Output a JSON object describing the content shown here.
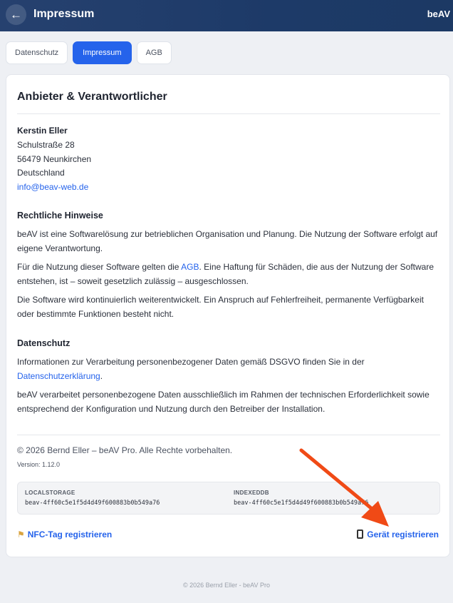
{
  "header": {
    "title": "Impressum",
    "brand": "beAV",
    "back_icon": "←"
  },
  "tabs": [
    {
      "label": "Datenschutz",
      "active": false
    },
    {
      "label": "Impressum",
      "active": true
    },
    {
      "label": "AGB",
      "active": false
    }
  ],
  "card": {
    "title": "Anbieter & Verantwortlicher",
    "provider": {
      "name": "Kerstin Eller",
      "street": "Schulstraße 28",
      "city": "56479 Neunkirchen",
      "country": "Deutschland",
      "email": "info@beav-web.de"
    },
    "legal": {
      "heading": "Rechtliche Hinweise",
      "p1": "beAV ist eine Softwarelösung zur betrieblichen Organisation und Planung. Die Nutzung der Software erfolgt auf eigene Verantwortung.",
      "p2_before": "Für die Nutzung dieser Software gelten die ",
      "p2_link": "AGB",
      "p2_after": ". Eine Haftung für Schäden, die aus der Nutzung der Software entstehen, ist – soweit gesetzlich zulässig – ausgeschlossen.",
      "p3": "Die Software wird kontinuierlich weiterentwickelt. Ein Anspruch auf Fehlerfreiheit, permanente Verfügbarkeit oder bestimmte Funktionen besteht nicht."
    },
    "privacy": {
      "heading": "Datenschutz",
      "p1_before": "Informationen zur Verarbeitung personenbezogener Daten gemäß DSGVO finden Sie in der ",
      "p1_link": "Datenschutzerklärung",
      "p1_after": ".",
      "p2": "beAV verarbeitet personenbezogene Daten ausschließlich im Rahmen der technischen Erforderlichkeit sowie entsprechend der Konfiguration und Nutzung durch den Betreiber der Installation."
    },
    "copyright": "© 2026 Bernd Eller – beAV Pro. Alle Rechte vorbehalten.",
    "version": "Version: 1.12.0",
    "storage": {
      "localstorage_label": "LOCALSTORAGE",
      "localstorage_value": "beav-4ff60c5e1f5d4d49f600883b0b549a76",
      "indexeddb_label": "INDEXEDDB",
      "indexeddb_value": "beav-4ff60c5e1f5d4d49f600883b0b549a76"
    },
    "nfc_link": "NFC-Tag registrieren",
    "device_link": "Gerät registrieren"
  },
  "footer": "© 2026 Bernd Eller - beAV Pro",
  "colors": {
    "accent": "#2563eb",
    "header": "#1f3b68",
    "annotation_arrow": "#f04a16"
  }
}
